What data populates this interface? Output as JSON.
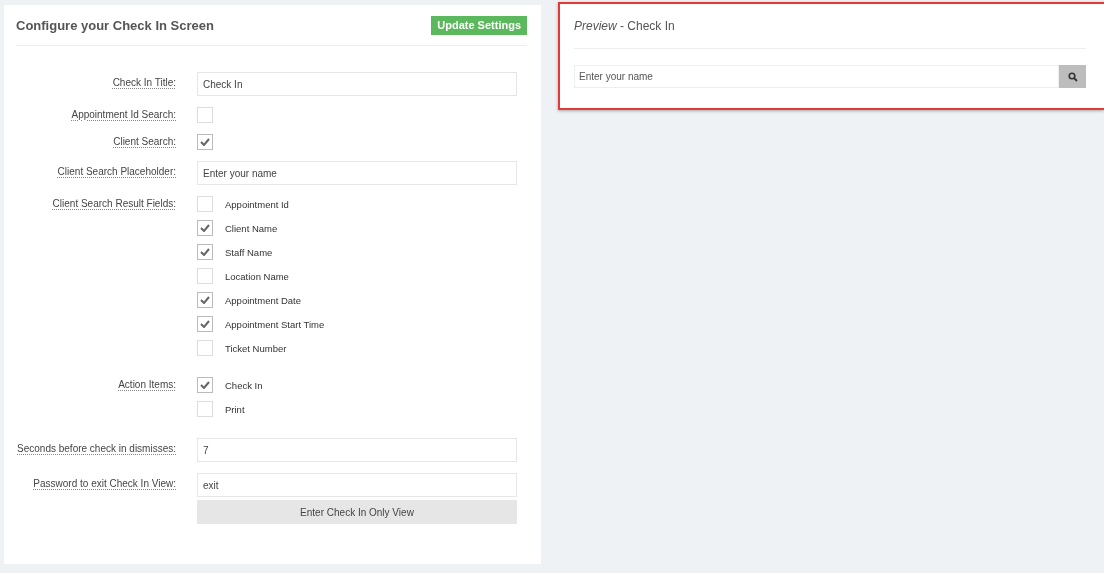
{
  "config": {
    "title": "Configure your Check In Screen",
    "update_button": "Update Settings",
    "rows": [
      {
        "kind": "text",
        "label": "Check In Title:",
        "value": "Check In"
      },
      {
        "kind": "checkbox",
        "label": "Appointment Id Search:",
        "checked": false
      },
      {
        "kind": "checkbox",
        "label": "Client Search:",
        "checked": true
      },
      {
        "kind": "text",
        "label": "Client Search Placeholder:",
        "value": "Enter your name"
      },
      {
        "kind": "checklist",
        "label": "Client Search Result Fields:",
        "options": [
          {
            "label": "Appointment Id",
            "checked": false
          },
          {
            "label": "Client Name",
            "checked": true
          },
          {
            "label": "Staff Name",
            "checked": true
          },
          {
            "label": "Location Name",
            "checked": false
          },
          {
            "label": "Appointment Date",
            "checked": true
          },
          {
            "label": "Appointment Start Time",
            "checked": true
          },
          {
            "label": "Ticket Number",
            "checked": false
          }
        ]
      },
      {
        "kind": "checklist",
        "label": "Action Items:",
        "options": [
          {
            "label": "Check In",
            "checked": true
          },
          {
            "label": "Print",
            "checked": false
          }
        ]
      },
      {
        "kind": "text",
        "label": "Seconds before check in dismisses:",
        "value": "7"
      },
      {
        "kind": "text",
        "label": "Password to exit Check In View:",
        "value": "exit"
      }
    ],
    "enter_button": "Enter Check In Only View"
  },
  "preview": {
    "title": "*Preview* - Check In",
    "highlighted": true,
    "search": {
      "placeholder": "Enter your name"
    }
  }
}
